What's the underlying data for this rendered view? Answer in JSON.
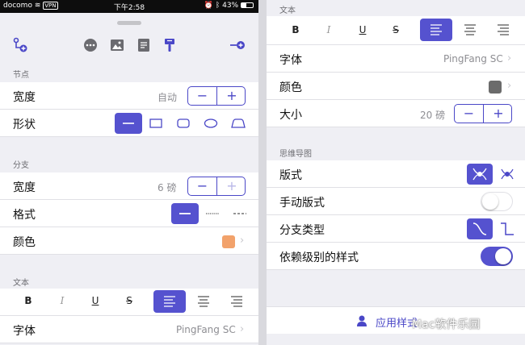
{
  "status_bar": {
    "carrier": "docomo",
    "vpn": "VPN",
    "time": "下午2:58",
    "battery": "43%"
  },
  "left": {
    "node_section": {
      "header": "节点",
      "width": {
        "label": "宽度",
        "value": "自动"
      },
      "shape": {
        "label": "形状"
      }
    },
    "branch_section": {
      "header": "分支",
      "width": {
        "label": "宽度",
        "value": "6 磅"
      },
      "style": {
        "label": "格式"
      },
      "color": {
        "label": "颜色",
        "swatch": "#f2a26b"
      }
    },
    "text_section": {
      "header": "文本",
      "format": {
        "bold": "B",
        "italic": "I",
        "underline": "U",
        "strike": "S"
      },
      "font": {
        "label": "字体",
        "value": "PingFang SC"
      }
    }
  },
  "right": {
    "text_section": {
      "header": "文本",
      "format": {
        "bold": "B",
        "italic": "I",
        "underline": "U",
        "strike": "S"
      },
      "font": {
        "label": "字体",
        "value": "PingFang SC"
      },
      "color": {
        "label": "颜色",
        "swatch": "#6b6b6b"
      },
      "size": {
        "label": "大小",
        "value": "20 磅"
      }
    },
    "mindmap_section": {
      "header": "思维导图",
      "layout": {
        "label": "版式"
      },
      "manual_layout": {
        "label": "手动版式",
        "on": false
      },
      "branch_type": {
        "label": "分支类型"
      },
      "level_style": {
        "label": "依赖级别的样式",
        "on": true
      }
    },
    "apply_button": "应用样式",
    "watermark": "Mac软件乐园"
  },
  "colors": {
    "accent": "#5552cf",
    "background": "#efeff4"
  }
}
